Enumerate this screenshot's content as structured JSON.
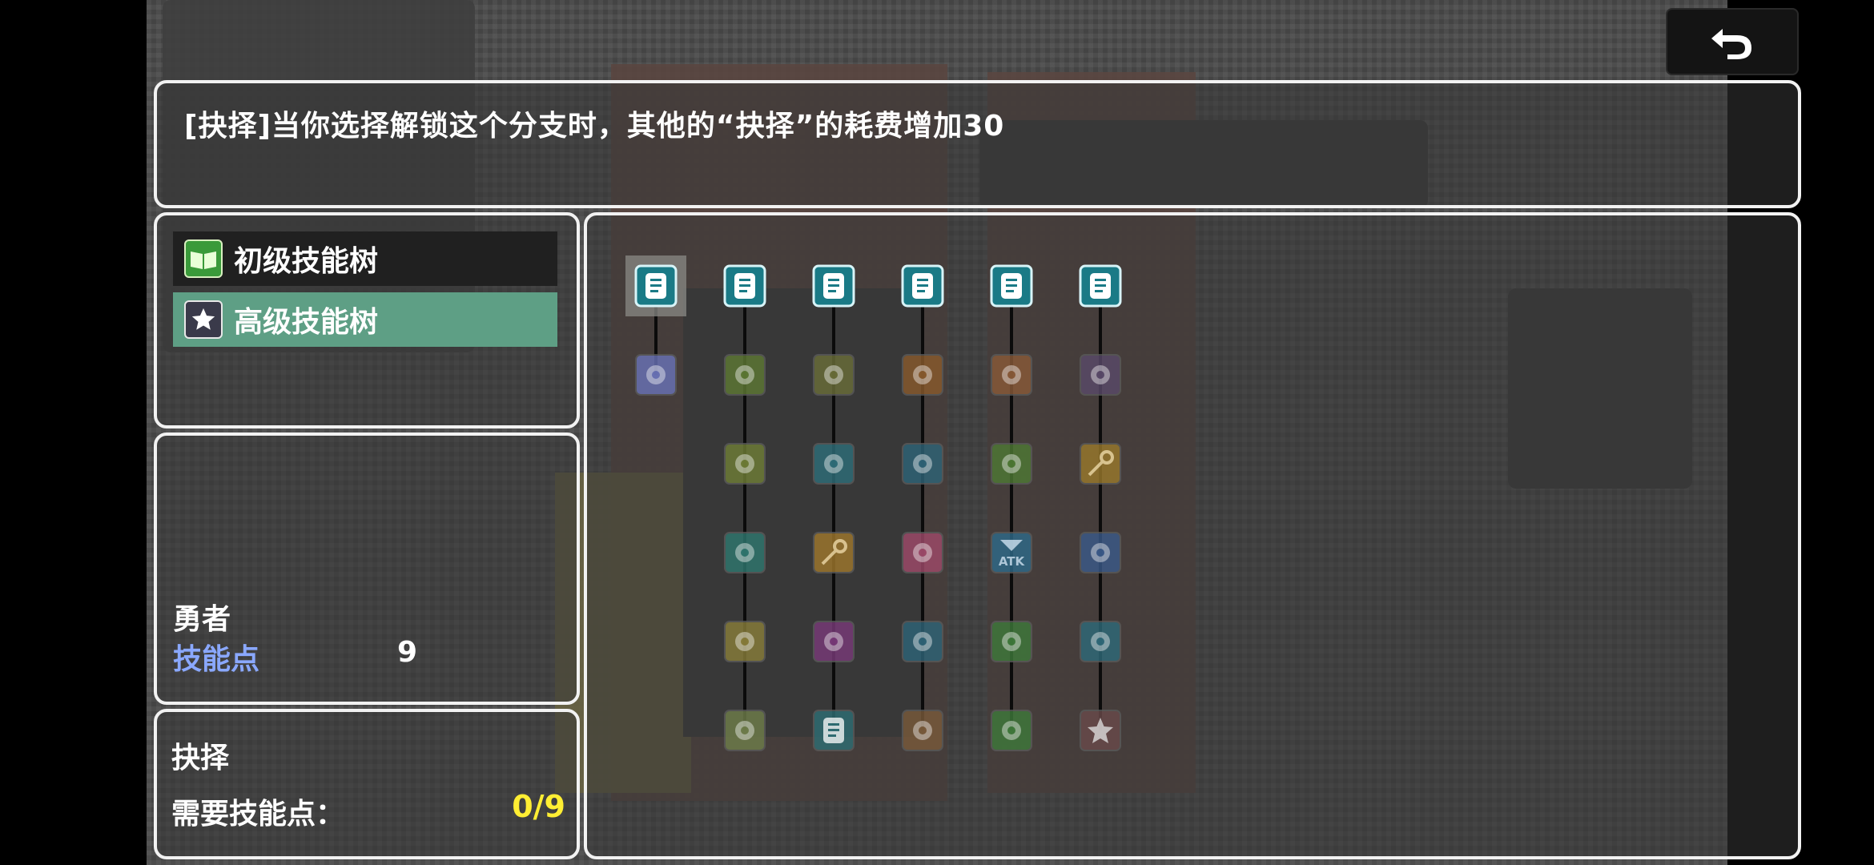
{
  "header": {
    "description": "[抉择]当你选择解锁这个分支时，其他的“抉择”的耗费增加30",
    "back_icon": "undo-arrow-icon"
  },
  "menu": {
    "items": [
      {
        "label": "初级技能树",
        "icon": "green-book-icon",
        "selected": false
      },
      {
        "label": "高级技能树",
        "icon": "star-icon",
        "selected": true
      }
    ]
  },
  "hero": {
    "name": "勇者",
    "skill_points_label": "技能点",
    "skill_points_value": "9"
  },
  "branch": {
    "name": "抉择",
    "required_label": "需要技能点：",
    "required_value": "0/9"
  },
  "skill_tree": {
    "columns": [
      {
        "nodes": [
          {
            "icon": "scroll-icon",
            "color": "#1a7a86",
            "active": true,
            "selected": true
          },
          {
            "icon": "flower-icon",
            "color": "#6a73b8"
          }
        ]
      },
      {
        "nodes": [
          {
            "icon": "scroll-icon",
            "color": "#1a7a86",
            "active": true
          },
          {
            "icon": "sun-leaf-icon",
            "color": "#5e7a34"
          },
          {
            "icon": "bow-icon",
            "color": "#6f7e36"
          },
          {
            "icon": "palm-icon",
            "color": "#2f7870"
          },
          {
            "icon": "feather-icon",
            "color": "#8a7e3a"
          },
          {
            "icon": "tornado-icon",
            "color": "#6f7e4a"
          }
        ]
      },
      {
        "nodes": [
          {
            "icon": "scroll-icon",
            "color": "#1a7a86",
            "active": true
          },
          {
            "icon": "bubbles-icon",
            "color": "#6a6e38"
          },
          {
            "icon": "statue-icon",
            "color": "#2e6e7a"
          },
          {
            "icon": "key-icon",
            "color": "#a0782c"
          },
          {
            "icon": "music-note-icon",
            "color": "#7a3a7a"
          },
          {
            "icon": "scroll-icon",
            "color": "#2e6e74"
          }
        ]
      },
      {
        "nodes": [
          {
            "icon": "scroll-icon",
            "color": "#1a7a86",
            "active": true
          },
          {
            "icon": "burst-icon",
            "color": "#8a5a2c"
          },
          {
            "icon": "hammer-icon",
            "color": "#2e6478"
          },
          {
            "icon": "sparkle-icon",
            "color": "#a04a6a"
          },
          {
            "icon": "pill-icon",
            "color": "#2e6478"
          },
          {
            "icon": "speech-bubble-icon",
            "color": "#7a5a3a"
          }
        ]
      },
      {
        "nodes": [
          {
            "icon": "scroll-icon",
            "color": "#1a7a86",
            "active": true
          },
          {
            "icon": "claw-icon",
            "color": "#8a5a38"
          },
          {
            "icon": "coins-icon",
            "color": "#4e7a34"
          },
          {
            "icon": "atk-icon",
            "color": "#2e6a8a",
            "text": "ATK"
          },
          {
            "icon": "swirl-icon",
            "color": "#3e7a3a"
          },
          {
            "icon": "head-icon",
            "color": "#3e7a3a"
          }
        ]
      },
      {
        "nodes": [
          {
            "icon": "scroll-icon",
            "color": "#1a7a86",
            "active": true
          },
          {
            "icon": "vortex-icon",
            "color": "#5a4a6a"
          },
          {
            "icon": "key-icon",
            "color": "#9a7a2c"
          },
          {
            "icon": "wave-icon",
            "color": "#3a5a8a"
          },
          {
            "icon": "butterfly-icon",
            "color": "#2e6a7a"
          },
          {
            "icon": "star-icon",
            "color": "#6a4a4a"
          }
        ]
      }
    ]
  }
}
